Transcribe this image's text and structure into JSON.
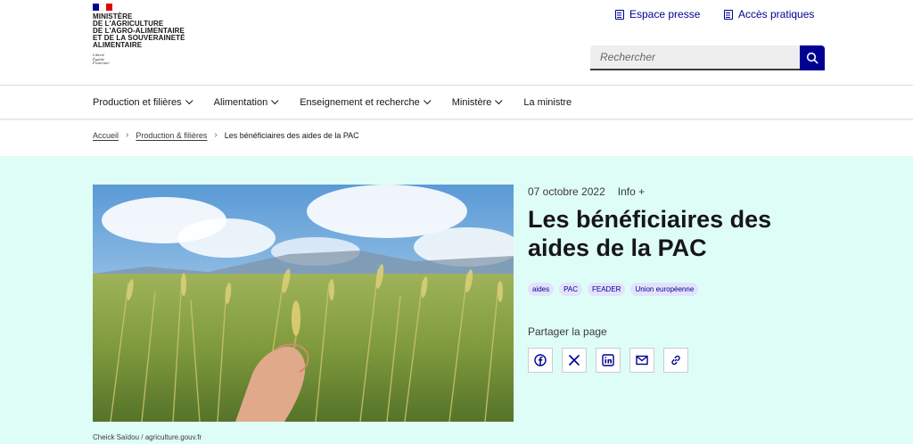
{
  "logo": {
    "text": "Ministère\nde l'Agriculture\nde l'Agro-alimentaire\net de la Souveraineté\nalimentaire",
    "devise": "Liberté\nÉgalité\nFraternité",
    "flag_colors": [
      "#000091",
      "#ffffff",
      "#e1000f"
    ]
  },
  "header": {
    "quick_links": [
      {
        "label": "Espace presse",
        "icon": "press-icon"
      },
      {
        "label": "Accès pratiques",
        "icon": "building-icon"
      }
    ],
    "search": {
      "placeholder": "Rechercher",
      "icon": "search-icon"
    }
  },
  "nav": {
    "items": [
      {
        "label": "Production et filières",
        "has_menu": true
      },
      {
        "label": "Alimentation",
        "has_menu": true
      },
      {
        "label": "Enseignement et recherche",
        "has_menu": true
      },
      {
        "label": "Ministère",
        "has_menu": true
      },
      {
        "label": "La ministre",
        "has_menu": false
      }
    ]
  },
  "breadcrumb": {
    "items": [
      "Accueil",
      "Production & filières"
    ],
    "current": "Les bénéficiaires des aides de la PAC"
  },
  "article": {
    "date": "07 octobre 2022",
    "category": "Info +",
    "title": "Les bénéficiaires des aides de la PAC",
    "tags": [
      "aides",
      "PAC",
      "FEADER",
      "Union européenne"
    ],
    "share_label": "Partager la page",
    "share_buttons": [
      "facebook-icon",
      "x-icon",
      "linkedin-icon",
      "mail-icon",
      "link-icon"
    ],
    "image_credit": "Cheick Saïdou / agriculture.gouv.fr"
  },
  "colors": {
    "accent": "#000091",
    "hero_bg": "#dffdf7",
    "tag_bg": "#e3e3fd",
    "marianne_red": "#e1000f"
  }
}
